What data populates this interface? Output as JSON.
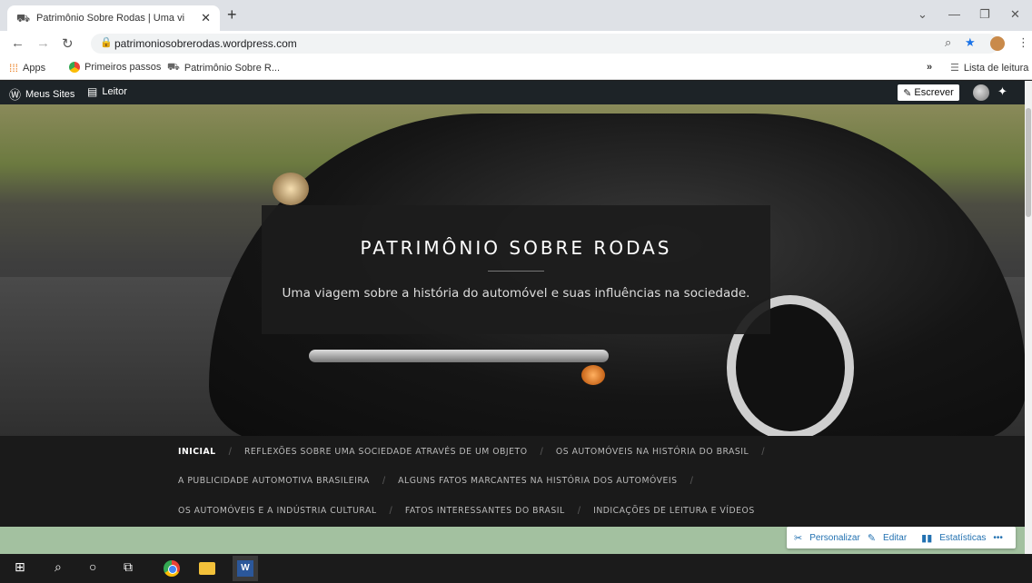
{
  "browser": {
    "tab_title": "Patrimônio Sobre Rodas | Uma vi",
    "url": "patrimoniosobrerodas.wordpress.com",
    "bookmarks": [
      "Apps",
      "Primeiros passos",
      "Patrimônio Sobre R..."
    ],
    "reading_list": "Lista de leitura",
    "more": "»"
  },
  "admin_bar": {
    "my_sites": "Meus Sites",
    "reader": "Leitor",
    "write": "Escrever"
  },
  "hero": {
    "title": "PATRIMÔNIO SOBRE RODAS",
    "subtitle": "Uma viagem sobre a história do automóvel e suas influências na sociedade."
  },
  "menu": {
    "row1": [
      "INICIAL",
      "REFLEXÕES SOBRE UMA SOCIEDADE ATRAVÉS DE UM OBJETO",
      "OS AUTOMÓVEIS NA HISTÓRIA DO BRASIL"
    ],
    "row2": [
      "A PUBLICIDADE AUTOMOTIVA BRASILEIRA",
      "ALGUNS FATOS MARCANTES NA HISTÓRIA DOS AUTOMÓVEIS"
    ],
    "row3": [
      "OS AUTOMÓVEIS E A INDÚSTRIA CULTURAL",
      "FATOS INTERESSANTES DO BRASIL",
      "INDICAÇÕES DE LEITURA E VÍDEOS"
    ]
  },
  "footer_tools": {
    "customize": "Personalizar",
    "edit": "Editar",
    "stats": "Estatísticas",
    "more": "•••"
  },
  "colors": {
    "wp_bar": "#1d2327",
    "hero_box": "#1c1c1c",
    "menu_bg": "#1a1a1a",
    "green_bar": "#a3c1a0",
    "accent_blue": "#2271b1"
  }
}
